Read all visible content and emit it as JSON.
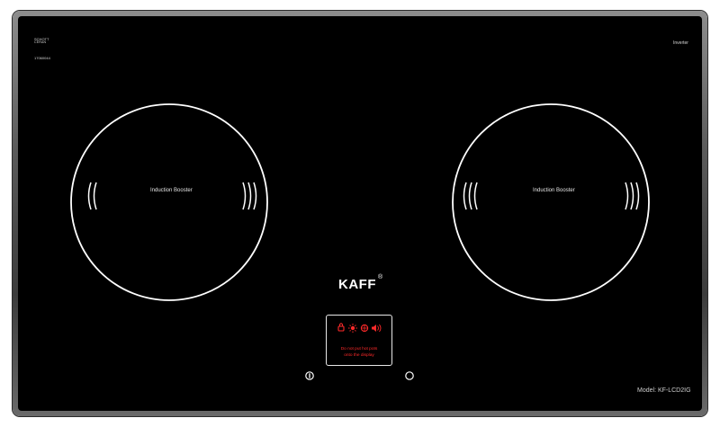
{
  "brand": {
    "logo_text": "KAFF",
    "registered_mark": "®",
    "maker_mark_top": "SCHOTT",
    "maker_mark_bottom": "CERAN",
    "serial": "17060044",
    "feature": "Inverter",
    "model": "Model: KF-LCD2IG"
  },
  "zones": [
    {
      "label": "Induction Booster"
    },
    {
      "label": "Induction Booster"
    }
  ],
  "control_panel": {
    "indicators": [
      "lock-icon",
      "sun-icon",
      "timer-icon",
      "speaker-icon"
    ],
    "warning_line_1": "Do not put hot pots",
    "warning_line_2": "onto the display"
  },
  "touch_controls": [
    "power-icon",
    "circle-button"
  ],
  "colors": {
    "glass": "#000000",
    "frame": "#6a6a6a",
    "warning_red": "#ff2a2a",
    "text": "#ffffff"
  }
}
